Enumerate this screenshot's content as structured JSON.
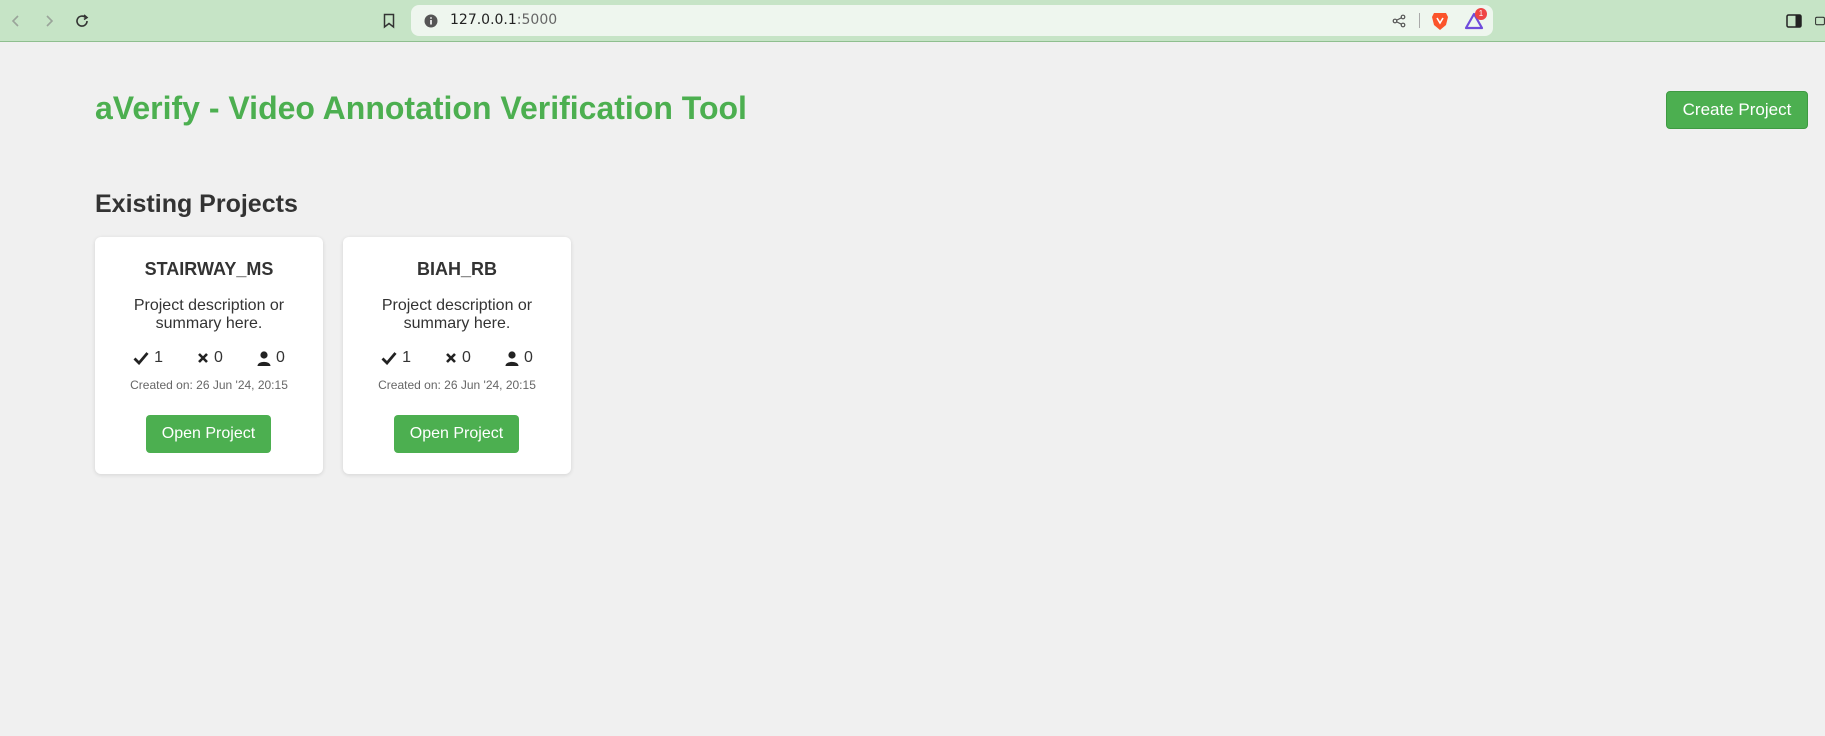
{
  "browser": {
    "url_host": "127.0.0.1",
    "url_port": ":5000",
    "extension_badge": "1"
  },
  "page": {
    "title": "aVerify - Video Annotation Verification Tool",
    "create_button": "Create Project",
    "section_title": "Existing Projects"
  },
  "projects": [
    {
      "name": "STAIRWAY_MS",
      "description": "Project description or summary here.",
      "verified": "1",
      "rejected": "0",
      "users": "0",
      "created": "Created on: 26 Jun '24, 20:15",
      "open_label": "Open Project"
    },
    {
      "name": "BIAH_RB",
      "description": "Project description or summary here.",
      "verified": "1",
      "rejected": "0",
      "users": "0",
      "created": "Created on: 26 Jun '24, 20:15",
      "open_label": "Open Project"
    }
  ],
  "colors": {
    "accent": "#4caf50",
    "background": "#f0f0f0",
    "browser_bar": "#c6e4c6"
  }
}
